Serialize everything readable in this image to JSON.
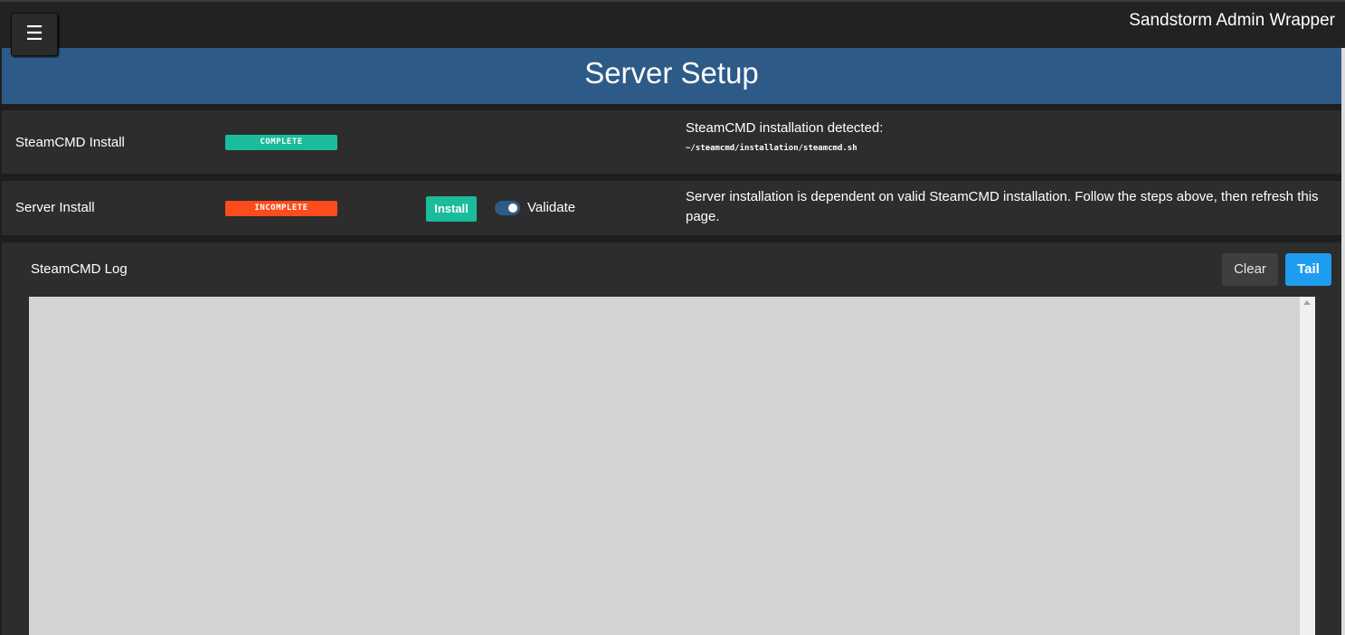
{
  "topbar": {
    "menu_icon": "☰",
    "app_title": "Sandstorm Admin Wrapper"
  },
  "header": {
    "title": "Server Setup"
  },
  "steamcmd_row": {
    "label": "SteamCMD Install",
    "status": "COMPLETE",
    "description": "SteamCMD installation detected:",
    "path": "~/steamcmd/installation/steamcmd.sh"
  },
  "server_row": {
    "label": "Server Install",
    "status": "INCOMPLETE",
    "install_label": "Install",
    "validate_label": "Validate",
    "validate_enabled": true,
    "description": "Server installation is dependent on valid SteamCMD installation. Follow the steps above, then refresh this page."
  },
  "log": {
    "title": "SteamCMD Log",
    "clear_label": "Clear",
    "tail_label": "Tail",
    "content": ""
  },
  "colors": {
    "header_bg": "#2e5a87",
    "complete": "#1abc9c",
    "incomplete": "#fc4b1c",
    "tail": "#1e9cf0"
  }
}
